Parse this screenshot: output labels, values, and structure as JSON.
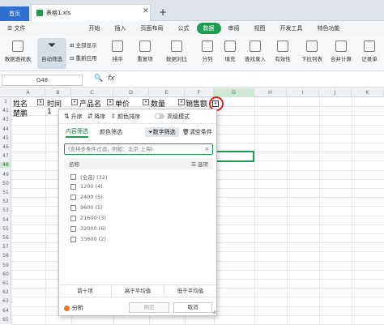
{
  "tabs": {
    "home": "首页",
    "file": "表格1.xls",
    "close": "✕",
    "add": "+"
  },
  "menu": {
    "hamburger": "☰ 文件",
    "items": [
      "开始",
      "插入",
      "页面布局",
      "公式",
      "数据",
      "审阅",
      "视图",
      "开发工具",
      "特色功能"
    ],
    "active": "数据"
  },
  "ribbon": {
    "pivot": "数据透视表",
    "autofilter": "自动筛选",
    "show_all": "全部显示",
    "reapply": "重新应用",
    "sort": "排序",
    "duplicates": "重复项",
    "compare": "数据对比",
    "split": "分列",
    "fill": "填充",
    "lookup": "查找录入",
    "validity": "有效性",
    "dropdown": "下拉列表",
    "merge": "合并计算",
    "record": "记录单"
  },
  "formula": {
    "namebox": "G48",
    "zoom_icon": "🔍",
    "fx": "fx"
  },
  "columns": [
    "A",
    "B",
    "C",
    "D",
    "E",
    "F",
    "G",
    "H",
    "I",
    "J",
    "K"
  ],
  "rows": [
    "1",
    "41",
    "43",
    "44",
    "45",
    "46",
    "47",
    "48",
    "49",
    "50",
    "51",
    "52",
    "53",
    "54",
    "55",
    "56",
    "57",
    "58",
    "59",
    "60",
    "61",
    "62",
    "63",
    "64",
    "65"
  ],
  "headers": {
    "name": "姓名",
    "time": "时间",
    "product": "产品名",
    "price": "单价",
    "qty": "数量",
    "sales": "销售额"
  },
  "row41": {
    "name": "楚鹏",
    "time": "1"
  },
  "panel": {
    "asc": "升序",
    "desc": "降序",
    "color_sort": "颜色排序",
    "advanced": "高级模式",
    "tab_content": "内容筛选",
    "tab_color": "颜色筛选",
    "num_filter": "数字筛选",
    "clear": "清空条件",
    "search_placeholder": "(支持多条件过滤，例如：北京 上海)",
    "list_name": "名称",
    "list_options": "☰ 选项",
    "options": [
      "(全选) (32)",
      "1200 (4)",
      "2400 (5)",
      "9600 (5)",
      "21600 (3)",
      "32000 (6)",
      "33600 (2)"
    ],
    "quick": [
      "前十项",
      "高于平均值",
      "低于平均值"
    ],
    "analysis": "分析",
    "ok": "确定",
    "cancel": "取消"
  }
}
